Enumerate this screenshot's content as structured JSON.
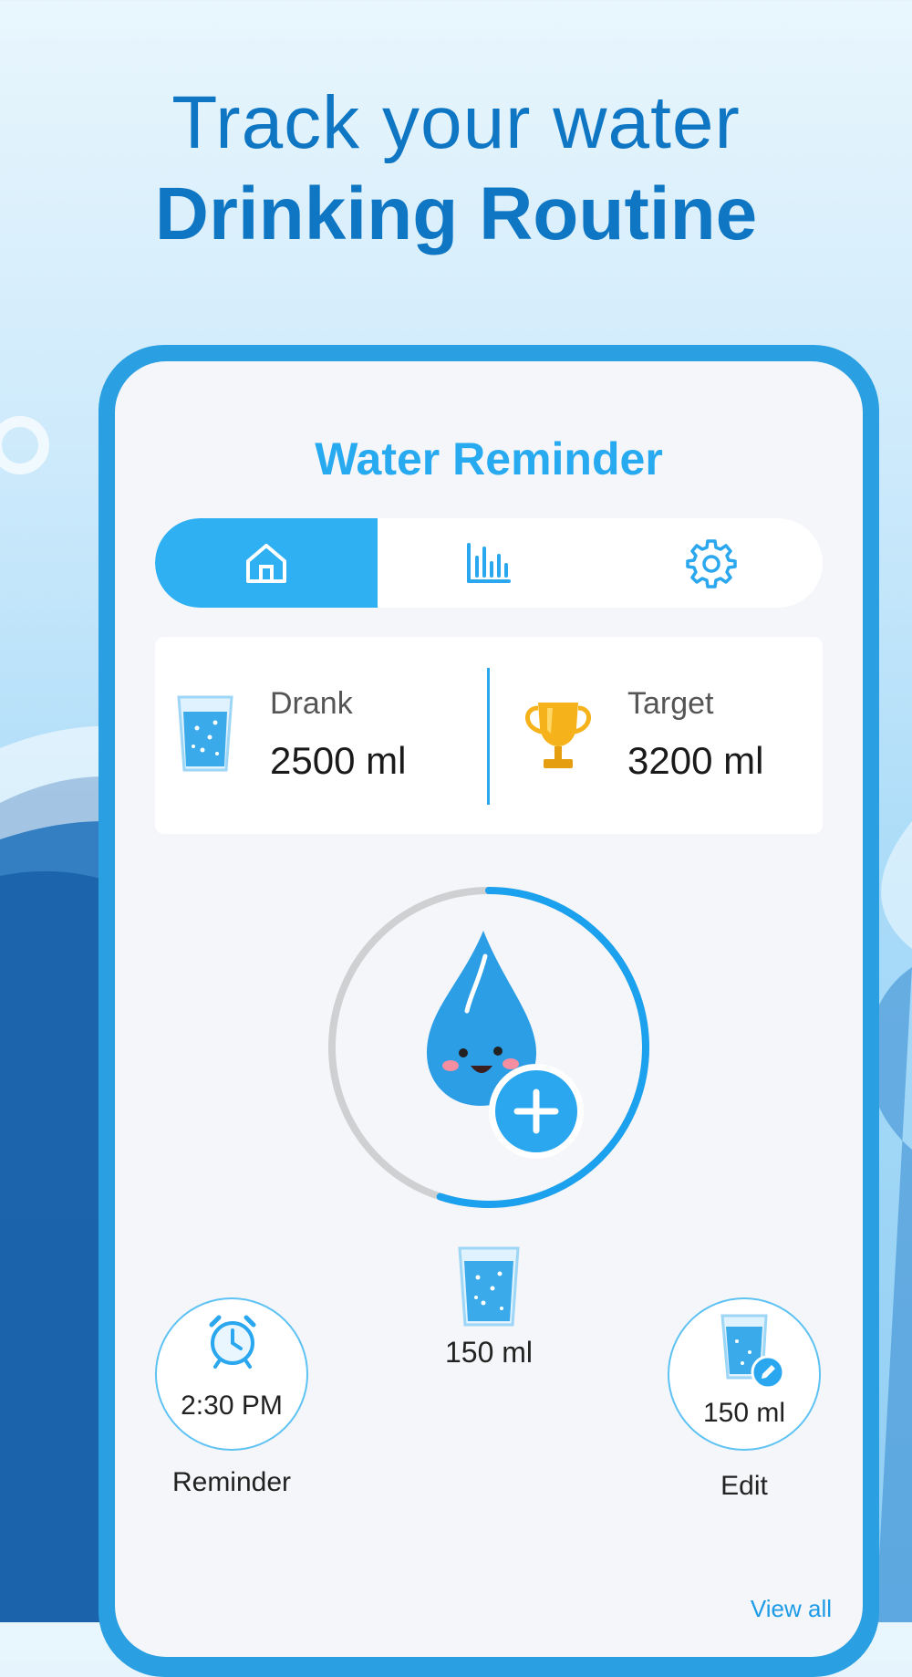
{
  "promo": {
    "line1": "Track your water",
    "line2": "Drinking Routine"
  },
  "app": {
    "title": "Water Reminder"
  },
  "tabs": [
    {
      "icon": "home-icon",
      "active": true
    },
    {
      "icon": "bar-chart-icon",
      "active": false
    },
    {
      "icon": "gear-icon",
      "active": false
    }
  ],
  "stats": {
    "drank_label": "Drank",
    "drank_value": "2500 ml",
    "target_label": "Target",
    "target_value": "3200 ml"
  },
  "progress": {
    "fraction": 0.55
  },
  "cup": {
    "amount": "150 ml"
  },
  "reminder": {
    "time": "2:30 PM",
    "label": "Reminder"
  },
  "edit": {
    "amount": "150 ml",
    "label": "Edit"
  },
  "history": {
    "view_all": "View all"
  },
  "colors": {
    "accent": "#2fb0f2",
    "frame": "#2a9fe2",
    "headline": "#0f76c4"
  }
}
